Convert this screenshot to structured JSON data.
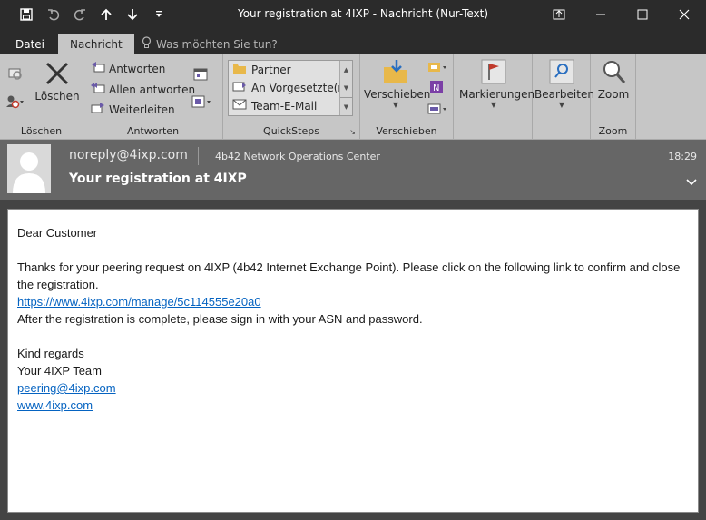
{
  "window": {
    "title": "Your registration at 4IXP - Nachricht (Nur-Text)",
    "qat_icons": [
      "save-icon",
      "undo-icon",
      "redo-icon",
      "up-arrow-icon",
      "down-arrow-icon",
      "customize-qat-icon"
    ],
    "controls": [
      "ribbon-display-options-icon",
      "minimize-icon",
      "maximize-icon",
      "close-icon"
    ]
  },
  "tabs": {
    "file": "Datei",
    "message": "Nachricht",
    "tell_me": "Was möchten Sie tun?"
  },
  "ribbon": {
    "delete_group": {
      "label": "Löschen",
      "delete_button": "Löschen"
    },
    "respond_group": {
      "label": "Antworten",
      "reply": "Antworten",
      "reply_all": "Allen antworten",
      "forward": "Weiterleiten"
    },
    "quicksteps_group": {
      "label": "QuickSteps",
      "items": [
        "Partner",
        "An Vorgesetzte(n)",
        "Team-E-Mail"
      ]
    },
    "move_group": {
      "label": "Verschieben",
      "move_button": "Verschieben"
    },
    "tags_group": {
      "flag_button": "Markierungen"
    },
    "edit_group": {
      "edit_button": "Bearbeiten"
    },
    "zoom_group": {
      "label": "Zoom",
      "zoom_button": "Zoom"
    }
  },
  "header": {
    "from": "noreply@4ixp.com",
    "organization": "4b42 Network Operations Center",
    "subject": "Your registration at 4IXP",
    "time": "18:29"
  },
  "body": {
    "greeting": "Dear Customer",
    "para1": "Thanks for your peering request on 4IXP (4b42 Internet Exchange Point). Please click on the following link to confirm and close the registration.",
    "confirm_link": "https://www.4ixp.com/manage/5c114555e20a0",
    "para2": "After the registration is complete, please sign in with your ASN and password.",
    "closing": "Kind regards",
    "signature": "Your 4IXP Team",
    "email_link": "peering@4ixp.com",
    "site_link": "www.4ixp.com"
  },
  "colors": {
    "titlebar": "#2b2b2b",
    "ribbon": "#c6c6c6",
    "header": "#666666",
    "link": "#0563c1"
  }
}
